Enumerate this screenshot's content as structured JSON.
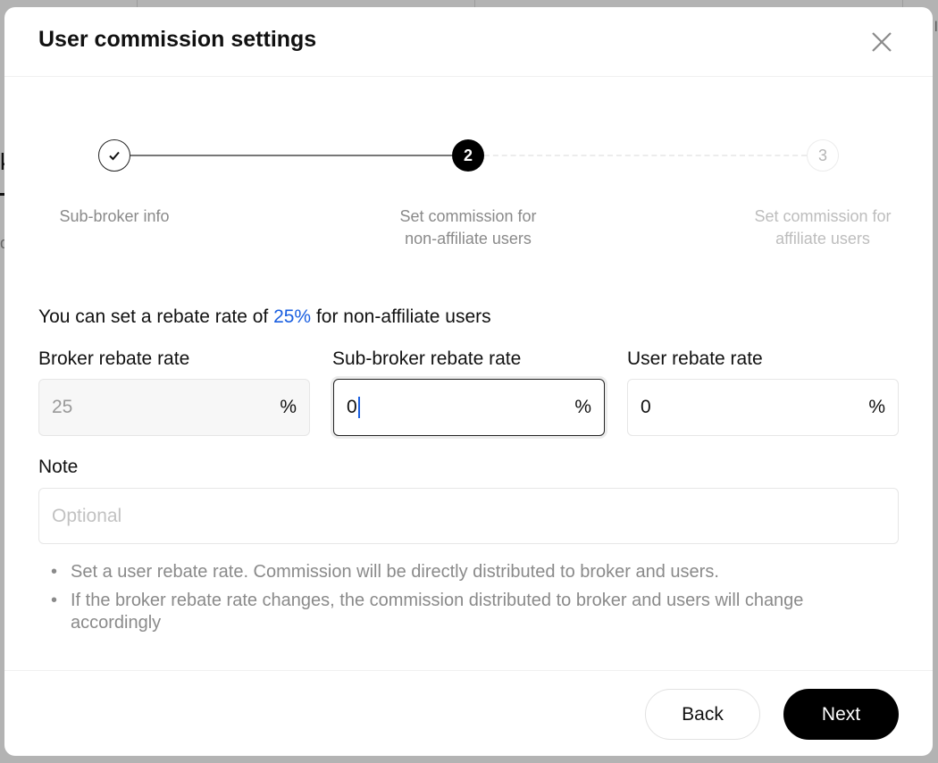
{
  "background": {
    "left_text_fragment": "k",
    "left_sub_fragment": "d",
    "right_text_fragment": "l"
  },
  "modal": {
    "title": "User commission settings",
    "close_icon": "close-icon"
  },
  "stepper": {
    "steps": [
      {
        "index": "1",
        "label_line1": "Sub-broker info",
        "label_line2": "",
        "status": "completed",
        "icon": "check-icon"
      },
      {
        "index": "2",
        "label_line1": "Set commission for",
        "label_line2": "non-affiliate users",
        "status": "active"
      },
      {
        "index": "3",
        "label_line1": "Set commission for",
        "label_line2": "affiliate users",
        "status": "pending"
      }
    ]
  },
  "form": {
    "info_prefix": "You can set a rebate rate of ",
    "info_highlight": "25%",
    "info_suffix": " for non-affiliate users",
    "highlight_color": "#1a5fe0",
    "broker_rate": {
      "label": "Broker rebate rate",
      "value": "25",
      "suffix": "%",
      "disabled": true
    },
    "sub_broker_rate": {
      "label": "Sub-broker rebate rate",
      "value": "0",
      "suffix": "%",
      "focused": true
    },
    "user_rate": {
      "label": "User rebate rate",
      "value": "0",
      "suffix": "%"
    },
    "note": {
      "label": "Note",
      "placeholder": "Optional",
      "value": ""
    },
    "tips": [
      "Set a user rebate rate. Commission will be directly distributed to broker and users.",
      "If the broker rebate rate changes, the commission distributed to broker and users will change accordingly"
    ],
    "bullet": "•"
  },
  "footer": {
    "back_label": "Back",
    "next_label": "Next"
  }
}
